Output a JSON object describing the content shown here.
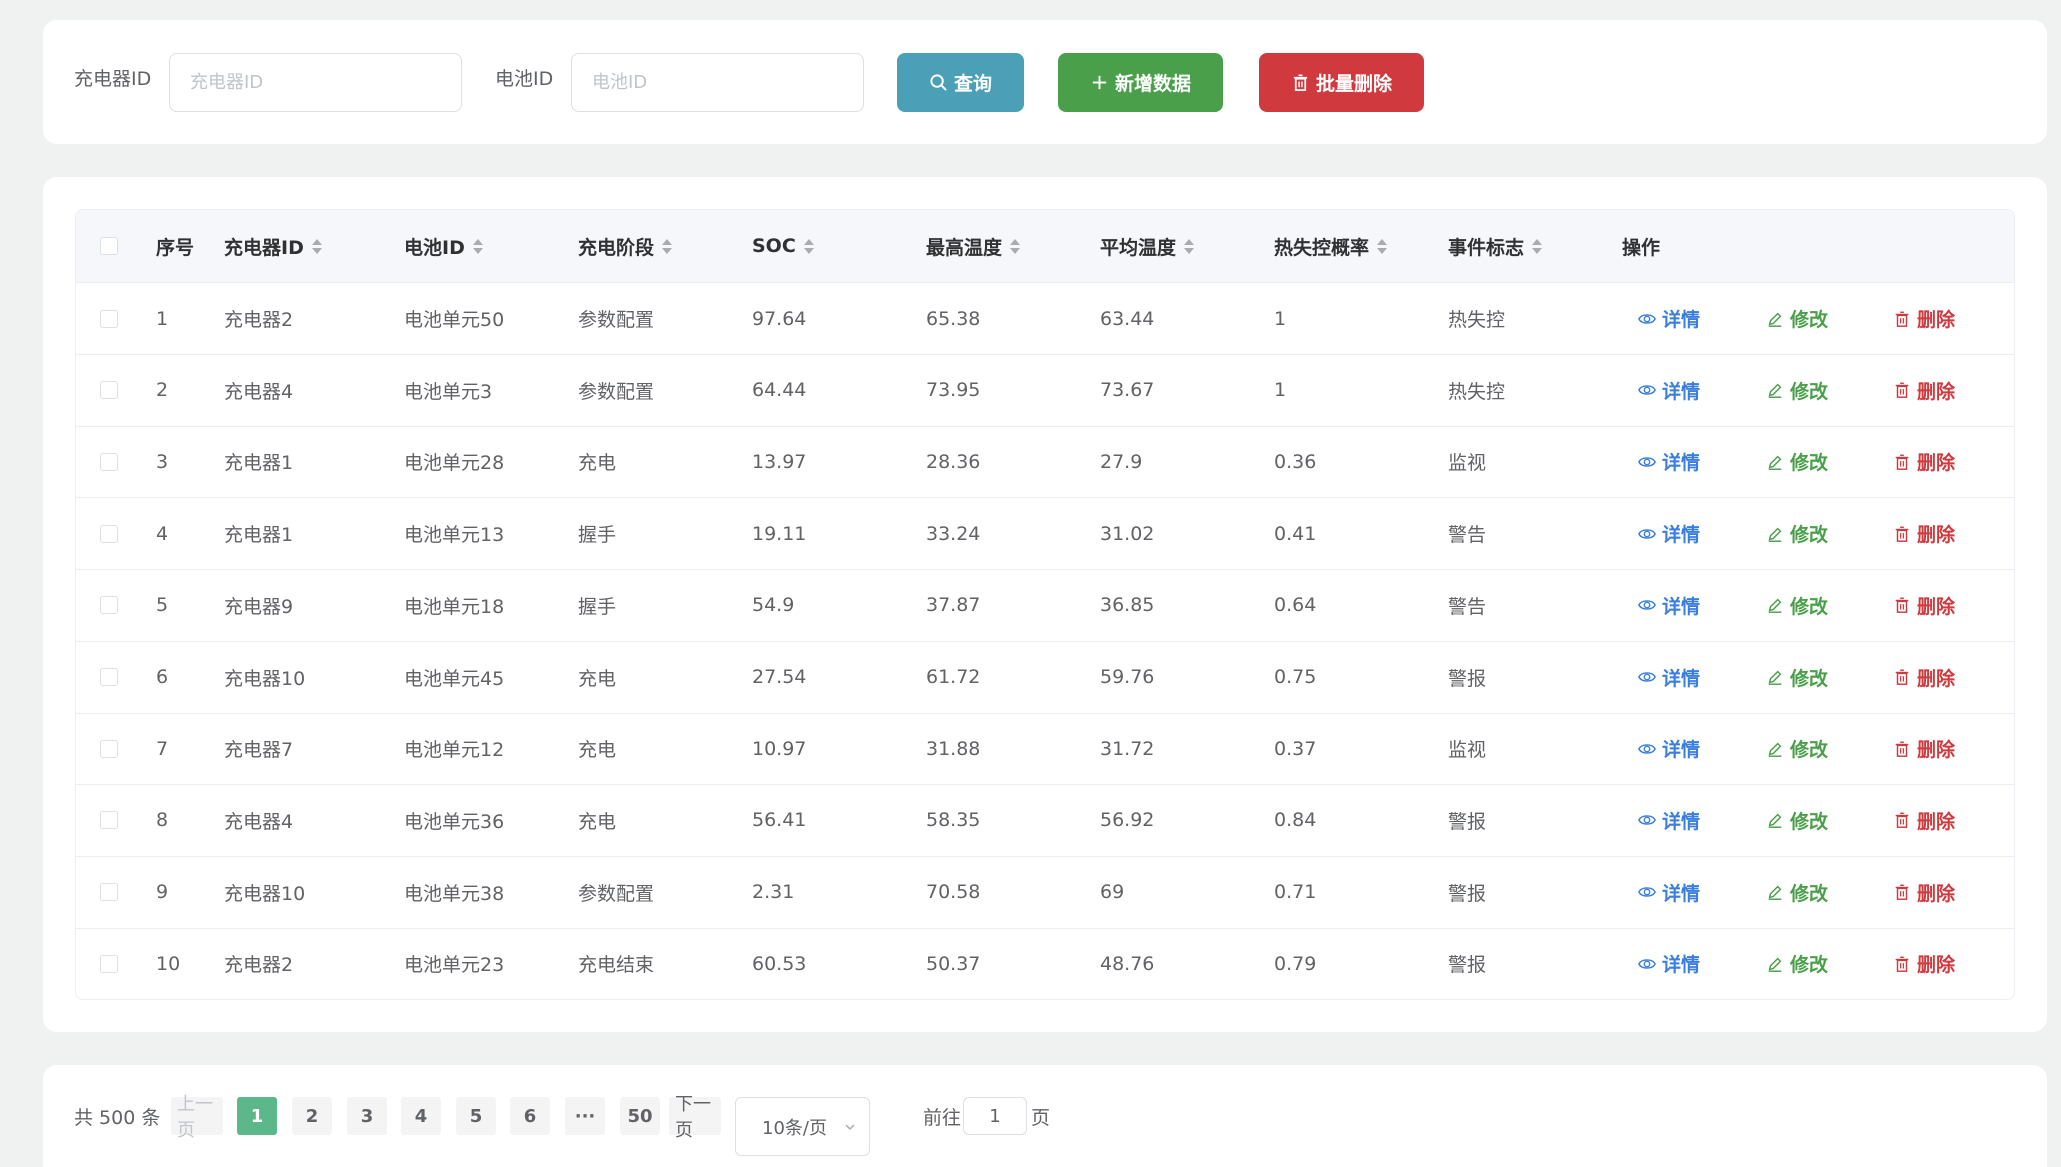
{
  "search": {
    "charger_label": "充电器ID",
    "charger_placeholder": "充电器ID",
    "battery_label": "电池ID",
    "battery_placeholder": "电池ID",
    "query_label": "查询",
    "add_label": "新增数据",
    "batch_delete_label": "批量删除"
  },
  "table": {
    "headers": [
      "序号",
      "充电器ID",
      "电池ID",
      "充电阶段",
      "SOC",
      "最高温度",
      "平均温度",
      "热失控概率",
      "事件标志",
      "操作"
    ],
    "actions": {
      "detail": "详情",
      "edit": "修改",
      "delete": "删除"
    },
    "rows": [
      [
        "1",
        "充电器2",
        "电池单元50",
        "参数配置",
        "97.64",
        "65.38",
        "63.44",
        "1",
        "热失控"
      ],
      [
        "2",
        "充电器4",
        "电池单元3",
        "参数配置",
        "64.44",
        "73.95",
        "73.67",
        "1",
        "热失控"
      ],
      [
        "3",
        "充电器1",
        "电池单元28",
        "充电",
        "13.97",
        "28.36",
        "27.9",
        "0.36",
        "监视"
      ],
      [
        "4",
        "充电器1",
        "电池单元13",
        "握手",
        "19.11",
        "33.24",
        "31.02",
        "0.41",
        "警告"
      ],
      [
        "5",
        "充电器9",
        "电池单元18",
        "握手",
        "54.9",
        "37.87",
        "36.85",
        "0.64",
        "警告"
      ],
      [
        "6",
        "充电器10",
        "电池单元45",
        "充电",
        "27.54",
        "61.72",
        "59.76",
        "0.75",
        "警报"
      ],
      [
        "7",
        "充电器7",
        "电池单元12",
        "充电",
        "10.97",
        "31.88",
        "31.72",
        "0.37",
        "监视"
      ],
      [
        "8",
        "充电器4",
        "电池单元36",
        "充电",
        "56.41",
        "58.35",
        "56.92",
        "0.84",
        "警报"
      ],
      [
        "9",
        "充电器10",
        "电池单元38",
        "参数配置",
        "2.31",
        "70.58",
        "69",
        "0.71",
        "警报"
      ],
      [
        "10",
        "充电器2",
        "电池单元23",
        "充电结束",
        "60.53",
        "50.37",
        "48.76",
        "0.79",
        "警报"
      ]
    ]
  },
  "pagination": {
    "total": "共 500 条",
    "prev": "上一页",
    "next": "下一页",
    "pages": [
      "1",
      "2",
      "3",
      "4",
      "5",
      "6",
      "···",
      "50"
    ],
    "current": "1",
    "page_size": "10条/页",
    "goto_label": "前往",
    "goto_value": "1",
    "goto_unit": "页"
  },
  "colors": {
    "query": "#4b9fb6",
    "add": "#4a9f4a",
    "delete": "#d03a3f",
    "detail": "#3a7ee0",
    "active_page": "#5cb88a"
  }
}
